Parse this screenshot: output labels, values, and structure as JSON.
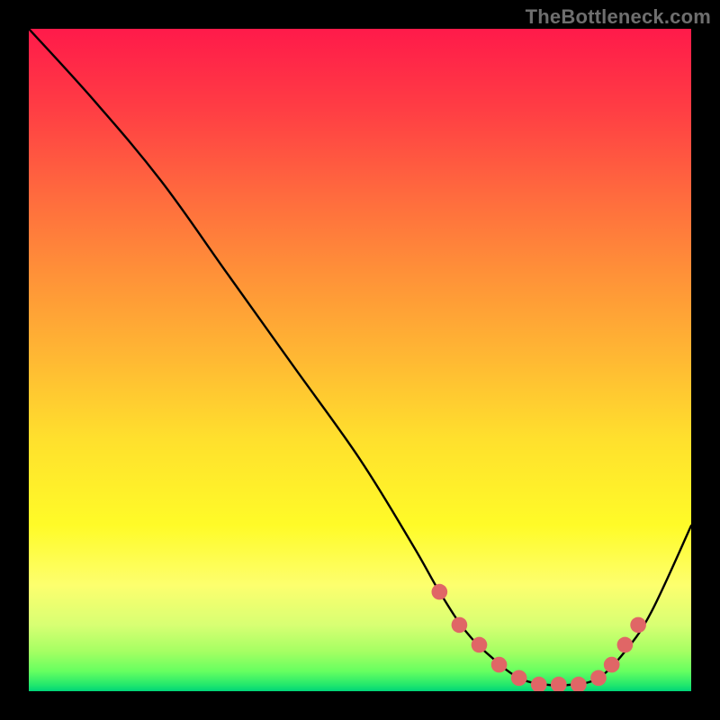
{
  "watermark": "TheBottleneck.com",
  "chart_data": {
    "type": "line",
    "title": "",
    "xlabel": "",
    "ylabel": "",
    "xlim": [
      0,
      100
    ],
    "ylim": [
      0,
      100
    ],
    "grid": false,
    "curve": {
      "x": [
        0,
        10,
        20,
        30,
        40,
        50,
        58,
        62,
        66,
        70,
        74,
        78,
        82,
        86,
        90,
        94,
        100
      ],
      "y": [
        100,
        89,
        77,
        63,
        49,
        35,
        22,
        15,
        9,
        5,
        2,
        1,
        1,
        2,
        6,
        12,
        25
      ]
    },
    "markers": {
      "color": "#e06666",
      "radius_pct": 1.2,
      "x": [
        62,
        65,
        68,
        71,
        74,
        77,
        80,
        83,
        86,
        88,
        90,
        92
      ],
      "y": [
        15,
        10,
        7,
        4,
        2,
        1,
        1,
        1,
        2,
        4,
        7,
        10
      ]
    },
    "gradient_colors": {
      "top": "#ff1a4a",
      "mid": "#ffe02d",
      "bottom": "#00d478"
    }
  }
}
